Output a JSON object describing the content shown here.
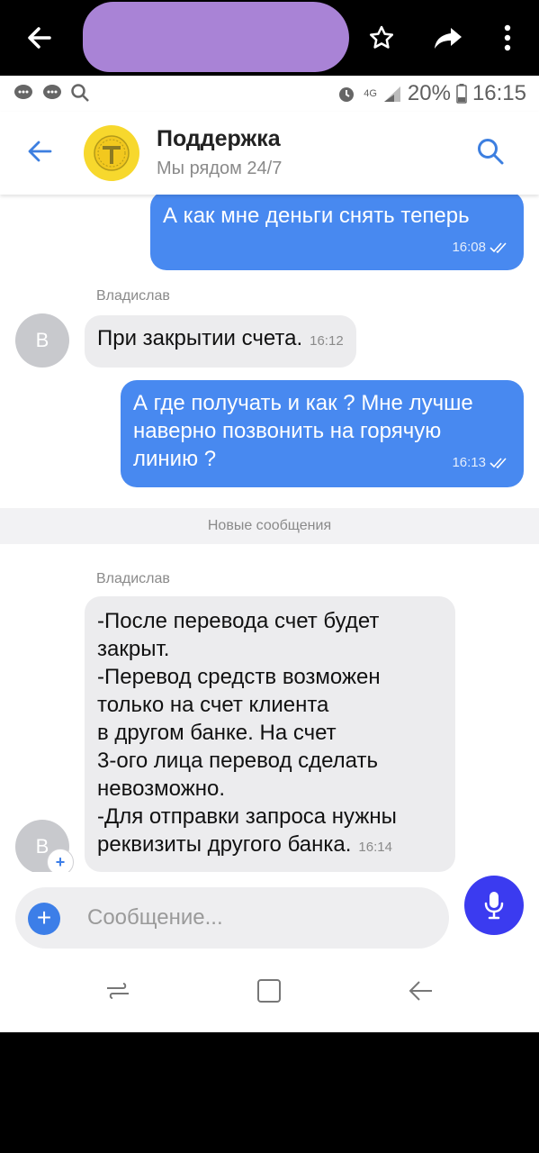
{
  "header": {
    "title": "Поддержка",
    "subtitle": "Мы рядом 24/7"
  },
  "statusbar": {
    "network": "4G",
    "battery": "20%",
    "time": "16:15"
  },
  "messages": [
    {
      "dir": "out",
      "text": "А как мне деньги снять теперь",
      "time": "16:08"
    },
    {
      "dir": "in",
      "sender": "Владислав",
      "avatar": "В",
      "text": "При закрытии счета.",
      "time": "16:12"
    },
    {
      "dir": "out",
      "lines": [
        "А где получать и как ? Мне лучше",
        "наверно позвонить на горячую",
        "линию ?"
      ],
      "time": "16:13"
    },
    {
      "dir": "in",
      "sender": "Владислав",
      "avatar": "В",
      "lines": [
        "-После перевода счет будет",
        "закрыт.",
        "-Перевод средств возможен",
        "только на счет клиента",
        "в другом банке. На счет",
        "3-ого лица перевод сделать",
        "невозможно.",
        "-Для отправки запроса нужны",
        "реквизиты другого банка."
      ],
      "time": "16:14"
    }
  ],
  "divider": "Новые сообщения",
  "composer": {
    "placeholder": "Сообщение..."
  },
  "colors": {
    "outgoing": "#4889f0",
    "incoming": "#ececee",
    "mic": "#3b3bf0",
    "redaction": "#a983d6"
  }
}
